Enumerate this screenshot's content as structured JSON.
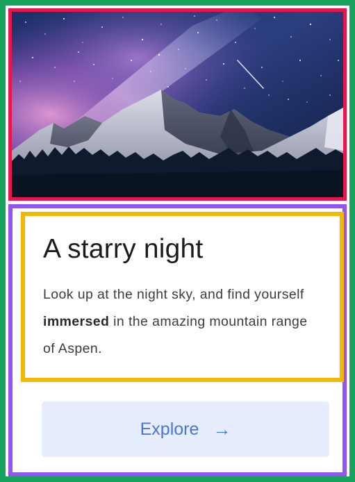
{
  "hero": {
    "image": "starry-night-mountain-photo",
    "icon": "photo"
  },
  "card": {
    "title": "A starry night",
    "description": {
      "before": "Look up at the night sky, and find yourself ",
      "emphasis": "immersed",
      "after": " in the amazing mountain range of Aspen."
    },
    "button": {
      "label": "Explore",
      "arrow": "→"
    }
  },
  "colors": {
    "frame_outer": "#17a35b",
    "frame_hero": "#e8174b",
    "frame_content": "#9256f0",
    "frame_text": "#f5b700",
    "button_bg": "#e6edfc",
    "button_text": "#4c74d6"
  }
}
